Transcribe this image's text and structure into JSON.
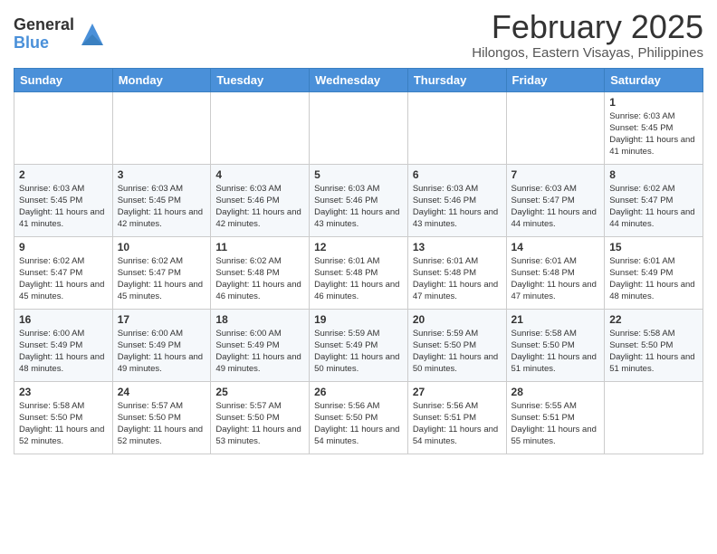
{
  "header": {
    "logo_general": "General",
    "logo_blue": "Blue",
    "month": "February 2025",
    "location": "Hilongos, Eastern Visayas, Philippines"
  },
  "weekdays": [
    "Sunday",
    "Monday",
    "Tuesday",
    "Wednesday",
    "Thursday",
    "Friday",
    "Saturday"
  ],
  "weeks": [
    [
      {
        "day": "",
        "sunrise": "",
        "sunset": "",
        "daylight": ""
      },
      {
        "day": "",
        "sunrise": "",
        "sunset": "",
        "daylight": ""
      },
      {
        "day": "",
        "sunrise": "",
        "sunset": "",
        "daylight": ""
      },
      {
        "day": "",
        "sunrise": "",
        "sunset": "",
        "daylight": ""
      },
      {
        "day": "",
        "sunrise": "",
        "sunset": "",
        "daylight": ""
      },
      {
        "day": "",
        "sunrise": "",
        "sunset": "",
        "daylight": ""
      },
      {
        "day": "1",
        "sunrise": "Sunrise: 6:03 AM",
        "sunset": "Sunset: 5:45 PM",
        "daylight": "Daylight: 11 hours and 41 minutes."
      }
    ],
    [
      {
        "day": "2",
        "sunrise": "Sunrise: 6:03 AM",
        "sunset": "Sunset: 5:45 PM",
        "daylight": "Daylight: 11 hours and 41 minutes."
      },
      {
        "day": "3",
        "sunrise": "Sunrise: 6:03 AM",
        "sunset": "Sunset: 5:45 PM",
        "daylight": "Daylight: 11 hours and 42 minutes."
      },
      {
        "day": "4",
        "sunrise": "Sunrise: 6:03 AM",
        "sunset": "Sunset: 5:46 PM",
        "daylight": "Daylight: 11 hours and 42 minutes."
      },
      {
        "day": "5",
        "sunrise": "Sunrise: 6:03 AM",
        "sunset": "Sunset: 5:46 PM",
        "daylight": "Daylight: 11 hours and 43 minutes."
      },
      {
        "day": "6",
        "sunrise": "Sunrise: 6:03 AM",
        "sunset": "Sunset: 5:46 PM",
        "daylight": "Daylight: 11 hours and 43 minutes."
      },
      {
        "day": "7",
        "sunrise": "Sunrise: 6:03 AM",
        "sunset": "Sunset: 5:47 PM",
        "daylight": "Daylight: 11 hours and 44 minutes."
      },
      {
        "day": "8",
        "sunrise": "Sunrise: 6:02 AM",
        "sunset": "Sunset: 5:47 PM",
        "daylight": "Daylight: 11 hours and 44 minutes."
      }
    ],
    [
      {
        "day": "9",
        "sunrise": "Sunrise: 6:02 AM",
        "sunset": "Sunset: 5:47 PM",
        "daylight": "Daylight: 11 hours and 45 minutes."
      },
      {
        "day": "10",
        "sunrise": "Sunrise: 6:02 AM",
        "sunset": "Sunset: 5:47 PM",
        "daylight": "Daylight: 11 hours and 45 minutes."
      },
      {
        "day": "11",
        "sunrise": "Sunrise: 6:02 AM",
        "sunset": "Sunset: 5:48 PM",
        "daylight": "Daylight: 11 hours and 46 minutes."
      },
      {
        "day": "12",
        "sunrise": "Sunrise: 6:01 AM",
        "sunset": "Sunset: 5:48 PM",
        "daylight": "Daylight: 11 hours and 46 minutes."
      },
      {
        "day": "13",
        "sunrise": "Sunrise: 6:01 AM",
        "sunset": "Sunset: 5:48 PM",
        "daylight": "Daylight: 11 hours and 47 minutes."
      },
      {
        "day": "14",
        "sunrise": "Sunrise: 6:01 AM",
        "sunset": "Sunset: 5:48 PM",
        "daylight": "Daylight: 11 hours and 47 minutes."
      },
      {
        "day": "15",
        "sunrise": "Sunrise: 6:01 AM",
        "sunset": "Sunset: 5:49 PM",
        "daylight": "Daylight: 11 hours and 48 minutes."
      }
    ],
    [
      {
        "day": "16",
        "sunrise": "Sunrise: 6:00 AM",
        "sunset": "Sunset: 5:49 PM",
        "daylight": "Daylight: 11 hours and 48 minutes."
      },
      {
        "day": "17",
        "sunrise": "Sunrise: 6:00 AM",
        "sunset": "Sunset: 5:49 PM",
        "daylight": "Daylight: 11 hours and 49 minutes."
      },
      {
        "day": "18",
        "sunrise": "Sunrise: 6:00 AM",
        "sunset": "Sunset: 5:49 PM",
        "daylight": "Daylight: 11 hours and 49 minutes."
      },
      {
        "day": "19",
        "sunrise": "Sunrise: 5:59 AM",
        "sunset": "Sunset: 5:49 PM",
        "daylight": "Daylight: 11 hours and 50 minutes."
      },
      {
        "day": "20",
        "sunrise": "Sunrise: 5:59 AM",
        "sunset": "Sunset: 5:50 PM",
        "daylight": "Daylight: 11 hours and 50 minutes."
      },
      {
        "day": "21",
        "sunrise": "Sunrise: 5:58 AM",
        "sunset": "Sunset: 5:50 PM",
        "daylight": "Daylight: 11 hours and 51 minutes."
      },
      {
        "day": "22",
        "sunrise": "Sunrise: 5:58 AM",
        "sunset": "Sunset: 5:50 PM",
        "daylight": "Daylight: 11 hours and 51 minutes."
      }
    ],
    [
      {
        "day": "23",
        "sunrise": "Sunrise: 5:58 AM",
        "sunset": "Sunset: 5:50 PM",
        "daylight": "Daylight: 11 hours and 52 minutes."
      },
      {
        "day": "24",
        "sunrise": "Sunrise: 5:57 AM",
        "sunset": "Sunset: 5:50 PM",
        "daylight": "Daylight: 11 hours and 52 minutes."
      },
      {
        "day": "25",
        "sunrise": "Sunrise: 5:57 AM",
        "sunset": "Sunset: 5:50 PM",
        "daylight": "Daylight: 11 hours and 53 minutes."
      },
      {
        "day": "26",
        "sunrise": "Sunrise: 5:56 AM",
        "sunset": "Sunset: 5:50 PM",
        "daylight": "Daylight: 11 hours and 54 minutes."
      },
      {
        "day": "27",
        "sunrise": "Sunrise: 5:56 AM",
        "sunset": "Sunset: 5:51 PM",
        "daylight": "Daylight: 11 hours and 54 minutes."
      },
      {
        "day": "28",
        "sunrise": "Sunrise: 5:55 AM",
        "sunset": "Sunset: 5:51 PM",
        "daylight": "Daylight: 11 hours and 55 minutes."
      },
      {
        "day": "",
        "sunrise": "",
        "sunset": "",
        "daylight": ""
      }
    ]
  ]
}
